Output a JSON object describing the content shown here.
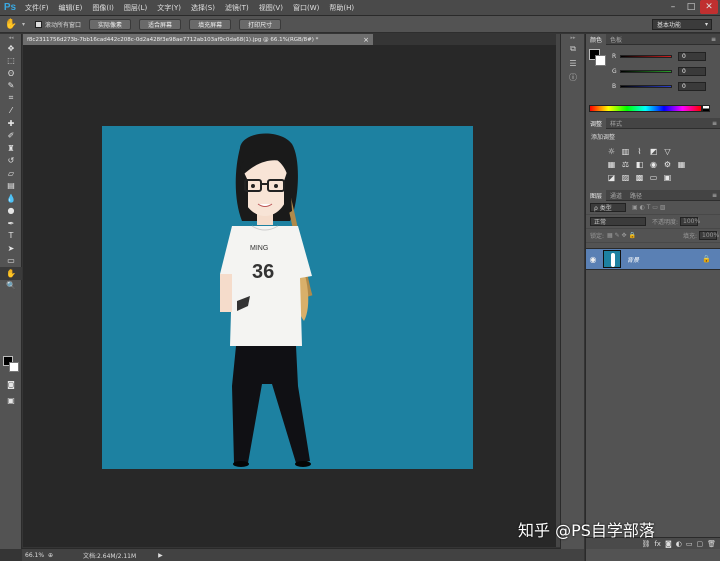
{
  "app": {
    "logo": "Ps"
  },
  "menu": [
    "文件(F)",
    "编辑(E)",
    "图像(I)",
    "图层(L)",
    "文字(Y)",
    "选择(S)",
    "滤镜(T)",
    "视图(V)",
    "窗口(W)",
    "帮助(H)"
  ],
  "window_controls": {
    "minimize": "–",
    "maximize": "□",
    "close": "✕"
  },
  "options": {
    "scroll_all_label": "滚动所有窗口",
    "btn_actual_pixels": "实际像素",
    "btn_fit_screen": "适合屏幕",
    "btn_fill_screen": "填充屏幕",
    "btn_print_size": "打印尺寸",
    "workspace": "基本功能"
  },
  "document": {
    "tab_title": "f8c2311756d273b-7bb16cad442c208c-0d2a428f3e98ae7712ab103af9c0da68(1).jpg @ 66.1%(RGB/8#) *",
    "close": "×"
  },
  "status": {
    "zoom": "66.1%",
    "doc_info": "文档:2.64M/2.11M",
    "arrow": "▶"
  },
  "color_panel": {
    "tabs": [
      "颜色",
      "色板"
    ],
    "r_label": "R",
    "g_label": "G",
    "b_label": "B",
    "r_value": "0",
    "g_value": "0",
    "b_value": "0",
    "colors": {
      "red": "#d11e1e",
      "green": "#2aa02a",
      "blue": "#2a3fd0"
    }
  },
  "adjustments_panel": {
    "tabs": [
      "调整",
      "样式"
    ],
    "title": "添加调整"
  },
  "layers_panel": {
    "tabs": [
      "图层",
      "通道",
      "路径"
    ],
    "filter_kind": "ρ 类型",
    "blend_mode": "正常",
    "opacity_label": "不透明度:",
    "opacity_value": "100%",
    "lock_label": "锁定:",
    "fill_label": "填充:",
    "fill_value": "100%",
    "layer_name": "背景"
  },
  "watermark": "知乎 @PS自学部落",
  "colors": {
    "canvas_bg": "#1d81a1",
    "selected_layer": "#5a80b4"
  }
}
